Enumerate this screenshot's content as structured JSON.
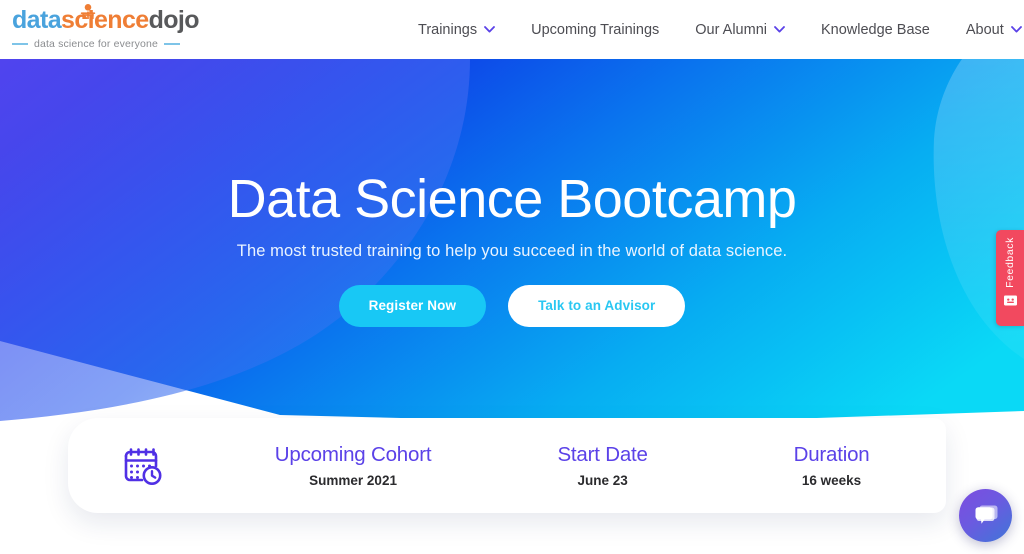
{
  "header": {
    "logo": {
      "part1": "data",
      "part2": "science",
      "part3": "dojo",
      "tagline": "data science for everyone"
    },
    "nav": [
      {
        "label": "Trainings",
        "has_chevron": true
      },
      {
        "label": "Upcoming Trainings",
        "has_chevron": false
      },
      {
        "label": "Our Alumni",
        "has_chevron": true
      },
      {
        "label": "Knowledge Base",
        "has_chevron": false
      },
      {
        "label": "About",
        "has_chevron": true
      }
    ]
  },
  "hero": {
    "title": "Data Science Bootcamp",
    "subtitle": "The most trusted training to help you succeed in the world of data science.",
    "primary_button": "Register Now",
    "secondary_button": "Talk to an Advisor"
  },
  "info_card": {
    "icon": "calendar-clock-icon",
    "columns": [
      {
        "label": "Upcoming Cohort",
        "value": "Summer 2021"
      },
      {
        "label": "Start Date",
        "value": "June 23"
      },
      {
        "label": "Duration",
        "value": "16 weeks"
      }
    ]
  },
  "widgets": {
    "feedback_label": "Feedback",
    "feedback_icon": "feedback-smiley-icon",
    "chat_icon": "chat-bubbles-icon"
  },
  "colors": {
    "logo_blue": "#4aa3dd",
    "logo_orange": "#ef7e35",
    "logo_gray": "#58595b",
    "nav_text": "#4d4d53",
    "chevron_purple": "#5b42e8",
    "hero_gradient_start": "#1010d8",
    "hero_gradient_end": "#0fd8f5",
    "cta_cyan": "#18c8f5",
    "cta_text_cyan": "#29c7f2",
    "info_label_purple": "#5b42e8",
    "feedback_red": "#f2495f",
    "chat_purple": "#7d4ce0"
  }
}
